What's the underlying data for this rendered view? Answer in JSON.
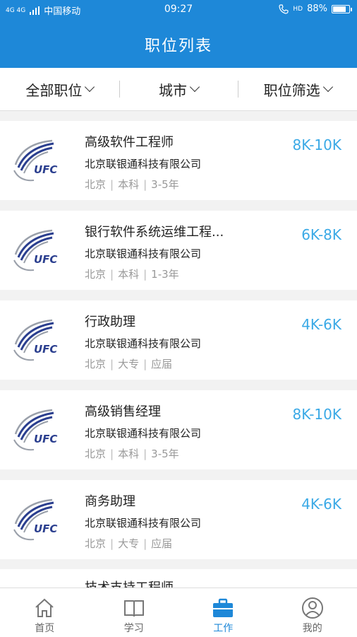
{
  "status": {
    "network": "4G 4G",
    "carrier": "中国移动",
    "time": "09:27",
    "hd": "HD",
    "battery": "88%",
    "battery_level": 0.88
  },
  "header": {
    "title": "职位列表"
  },
  "filters": [
    {
      "label": "全部职位"
    },
    {
      "label": "城市"
    },
    {
      "label": "职位筛选"
    }
  ],
  "jobs": [
    {
      "title": "高级软件工程师",
      "company": "北京联银通科技有限公司",
      "city": "北京",
      "education": "本科",
      "experience": "3-5年",
      "salary": "8K-10K"
    },
    {
      "title": "银行软件系统运维工程...",
      "company": "北京联银通科技有限公司",
      "city": "北京",
      "education": "本科",
      "experience": "1-3年",
      "salary": "6K-8K"
    },
    {
      "title": "行政助理",
      "company": "北京联银通科技有限公司",
      "city": "北京",
      "education": "大专",
      "experience": "应届",
      "salary": "4K-6K"
    },
    {
      "title": "高级销售经理",
      "company": "北京联银通科技有限公司",
      "city": "北京",
      "education": "本科",
      "experience": "3-5年",
      "salary": "8K-10K"
    },
    {
      "title": "商务助理",
      "company": "北京联银通科技有限公司",
      "city": "北京",
      "education": "大专",
      "experience": "应届",
      "salary": "4K-6K"
    },
    {
      "title": "技术支持工程师",
      "salary": ""
    }
  ],
  "company_logo_text": "UFC",
  "tabs": [
    {
      "label": "首页",
      "icon": "home-icon"
    },
    {
      "label": "学习",
      "icon": "book-icon"
    },
    {
      "label": "工作",
      "icon": "briefcase-icon",
      "active": true
    },
    {
      "label": "我的",
      "icon": "user-icon"
    }
  ],
  "colors": {
    "primary": "#1e88d8",
    "salary": "#3aa9e6"
  }
}
